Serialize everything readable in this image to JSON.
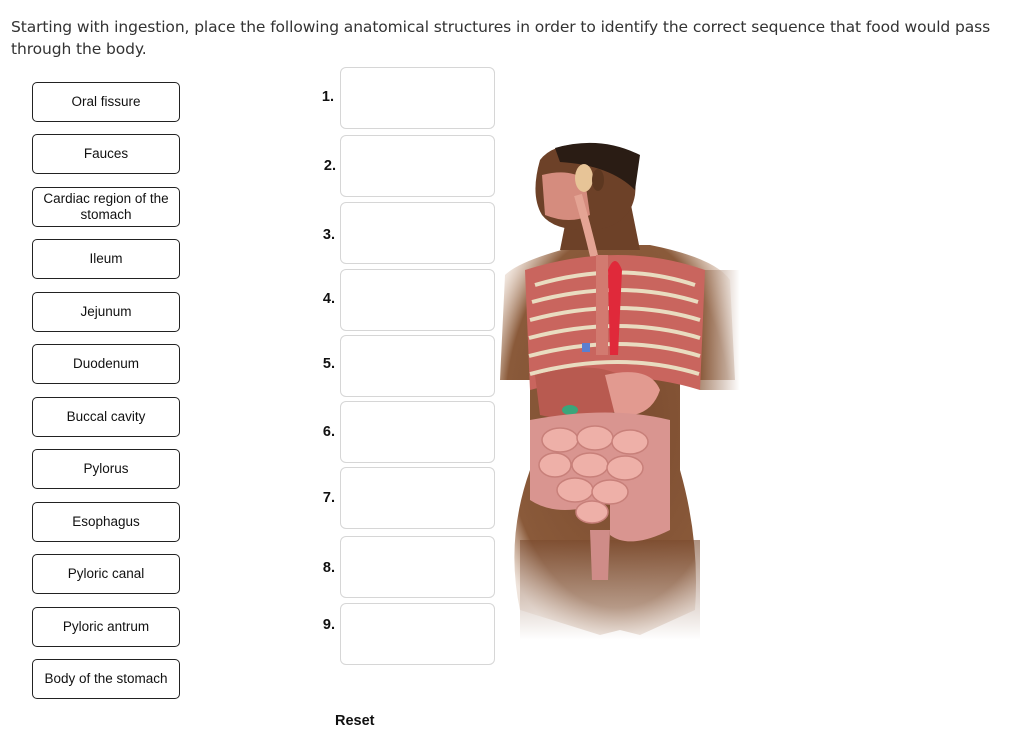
{
  "prompt": "Starting with ingestion, place the following anatomical structures in order to identify the correct sequence that food would pass through the body.",
  "labels": [
    "Oral fissure",
    "Fauces",
    "Cardiac region of the stomach",
    "Ileum",
    "Jejunum",
    "Duodenum",
    "Buccal cavity",
    "Pylorus",
    "Esophagus",
    "Pyloric canal",
    "Pyloric antrum",
    "Body of the stomach"
  ],
  "slots": [
    "1.",
    "2.",
    "3.",
    "4.",
    "5.",
    "6.",
    "7.",
    "8.",
    "9."
  ],
  "reset_label": "Reset",
  "figure": {
    "description": "Anatomical illustration of the human digestive system (head, thorax and abdomen)",
    "colors": {
      "skin": "#7a4a2e",
      "muscle": "#d4736b",
      "intestine": "#eeb0a8",
      "aorta": "#e0293a",
      "gallbladder": "#3aa57a",
      "rib": "#e9dcc0"
    }
  }
}
